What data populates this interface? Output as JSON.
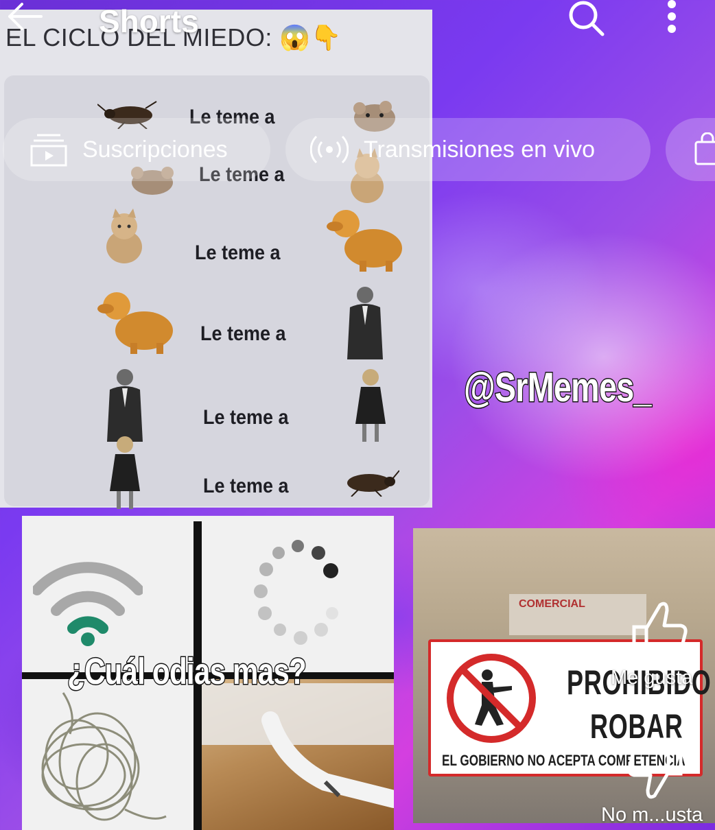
{
  "header": {
    "title": "Shorts",
    "back_icon": "arrow-left-icon",
    "search_icon": "search-icon",
    "more_icon": "more-vertical-icon"
  },
  "chips": [
    {
      "label": "Suscripciones",
      "icon": "subscriptions-icon"
    },
    {
      "label": "Transmisiones en vivo",
      "icon": "live-broadcast-icon"
    },
    {
      "label": "",
      "icon": "shopping-bag-icon"
    }
  ],
  "feed": {
    "meme_cycle": {
      "title": "EL CICLO DEL MIEDO: 😱👇",
      "rows": [
        {
          "left": "cockroach",
          "text": "Le teme a",
          "right": "mouse"
        },
        {
          "left": "mouse",
          "text": "Le teme a",
          "right": "cat"
        },
        {
          "left": "cat",
          "text": "Le teme a",
          "right": "dog"
        },
        {
          "left": "dog",
          "text": "Le teme a",
          "right": "man"
        },
        {
          "left": "man",
          "text": "Le teme a",
          "right": "woman"
        },
        {
          "left": "woman",
          "text": "Le teme a",
          "right": "cockroach"
        }
      ]
    },
    "watermark": "@SrMemes_",
    "meme_hate": {
      "caption": "¿Cuál odias mas?",
      "panels": [
        "wifi-weak-icon",
        "loading-spinner-icon",
        "tangled-cable",
        "broken-charger-cable"
      ]
    },
    "meme_rob": {
      "line1": "PROHIBIDO",
      "line2": "ROBAR",
      "footer": "EL GOBIERNO NO ACEPTA COMPETENCIA",
      "storefront_text": "COMERCIAL"
    }
  },
  "actions": {
    "like_label": "Me gusta",
    "dislike_label": "No m...usta"
  },
  "colors": {
    "accent_white": "#ffffff",
    "wifi_green": "#1f8a6a",
    "sign_red": "#d42a2a",
    "bg_purple": "#7a3af0",
    "bg_magenta": "#d43fe0"
  }
}
